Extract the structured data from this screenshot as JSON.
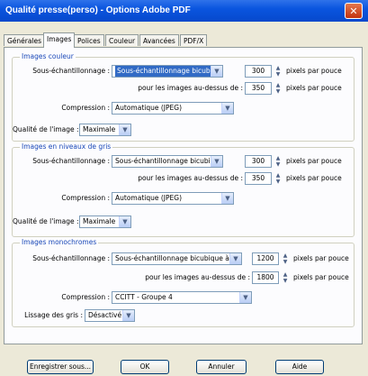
{
  "window": {
    "title": "Qualité presse(perso) - Options Adobe PDF"
  },
  "tabs": [
    {
      "label": "Générales"
    },
    {
      "label": "Images"
    },
    {
      "label": "Polices"
    },
    {
      "label": "Couleur"
    },
    {
      "label": "Avancées"
    },
    {
      "label": "PDF/X"
    }
  ],
  "active_tab": "Images",
  "groups": {
    "color": {
      "title": "Images couleur",
      "downsampling_label": "Sous-échantillonnage :",
      "downsampling_value": "Sous-échantillonnage bicubique à",
      "ppi_value": "300",
      "ppi_unit": "pixels par pouce",
      "above_label": "pour les images au-dessus de :",
      "above_value": "350",
      "above_unit": "pixels par pouce",
      "compression_label": "Compression :",
      "compression_value": "Automatique (JPEG)",
      "quality_label": "Qualité de l'image :",
      "quality_value": "Maximale"
    },
    "gray": {
      "title": "Images en niveaux de gris",
      "downsampling_label": "Sous-échantillonnage :",
      "downsampling_value": "Sous-échantillonnage bicubique à",
      "ppi_value": "300",
      "ppi_unit": "pixels par pouce",
      "above_label": "pour les images au-dessus de :",
      "above_value": "350",
      "above_unit": "pixels par pouce",
      "compression_label": "Compression :",
      "compression_value": "Automatique (JPEG)",
      "quality_label": "Qualité de l'image :",
      "quality_value": "Maximale"
    },
    "mono": {
      "title": "Images monochromes",
      "downsampling_label": "Sous-échantillonnage :",
      "downsampling_value": "Sous-échantillonnage bicubique à",
      "ppi_value": "1200",
      "ppi_unit": "pixels par pouce",
      "above_label": "pour les images au-dessus de :",
      "above_value": "1800",
      "above_unit": "pixels par pouce",
      "compression_label": "Compression :",
      "compression_value": "CCITT - Groupe 4",
      "smoothing_label": "Lissage des gris :",
      "smoothing_value": "Désactivé"
    }
  },
  "buttons": {
    "save": "Enregistrer sous...",
    "ok": "OK",
    "cancel": "Annuler",
    "help": "Aide"
  }
}
